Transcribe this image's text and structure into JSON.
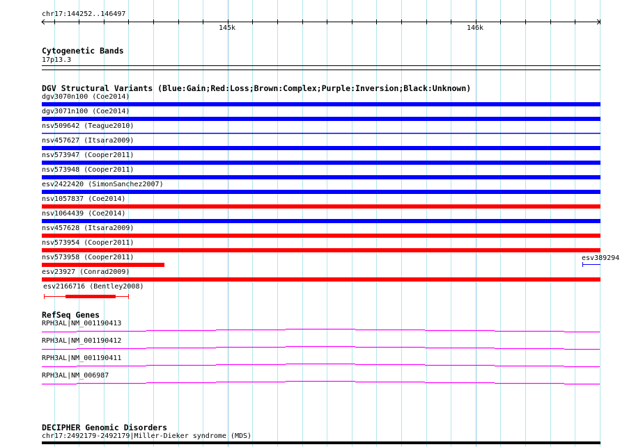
{
  "ruler": {
    "region": "chr17:144252..146497",
    "ticks": [
      "145k",
      "146k"
    ]
  },
  "cytoband": {
    "title": "Cytogenetic Bands",
    "band": "17p13.3"
  },
  "dgv": {
    "title": "DGV Structural Variants (Blue:Gain;Red:Loss;Brown:Complex;Purple:Inversion;Black:Unknown)",
    "colors": {
      "gain": "#0000ff",
      "loss": "#ff0000"
    },
    "variants": [
      {
        "label": "dgv3070n100 (Coe2014)",
        "type": "gain",
        "style": "bar"
      },
      {
        "label": "dgv3071n100 (Coe2014)",
        "type": "gain",
        "style": "bar"
      },
      {
        "label": "nsv509642 (Teague2010)",
        "type": "gain",
        "style": "line"
      },
      {
        "label": "nsv457627 (Itsara2009)",
        "type": "gain",
        "style": "bar"
      },
      {
        "label": "nsv573947 (Cooper2011)",
        "type": "gain",
        "style": "bar"
      },
      {
        "label": "nsv573948 (Cooper2011)",
        "type": "gain",
        "style": "bar"
      },
      {
        "label": "esv2422420 (SimonSanchez2007)",
        "type": "gain",
        "style": "bar"
      },
      {
        "label": "nsv1057837 (Coe2014)",
        "type": "loss",
        "style": "bar"
      },
      {
        "label": "nsv1064439 (Coe2014)",
        "type": "gain",
        "style": "bar"
      },
      {
        "label": "nsv457628 (Itsara2009)",
        "type": "loss",
        "style": "bar"
      },
      {
        "label": "nsv573954 (Cooper2011)",
        "type": "loss",
        "style": "bar"
      },
      {
        "label": "nsv573958 (Cooper2011)",
        "type": "loss",
        "style": "partial"
      },
      {
        "label": "esv23927 (Conrad2009)",
        "type": "loss",
        "style": "bar"
      },
      {
        "label": "esv2166716 (Bentley2008)",
        "type": "loss",
        "style": "range"
      }
    ],
    "extra": {
      "label": "esv3892945",
      "type": "gain"
    }
  },
  "refseq": {
    "title": "RefSeq Genes",
    "color": "#ff00ff",
    "genes": [
      "RPH3AL|NM_001190413",
      "RPH3AL|NM_001190412",
      "RPH3AL|NM_001190411",
      "RPH3AL|NM_006987"
    ]
  },
  "decipher": {
    "title": "DECIPHER Genomic Disorders",
    "item": "chr17:2492179-2492179|Miller-Dieker syndrome (MDS)"
  }
}
